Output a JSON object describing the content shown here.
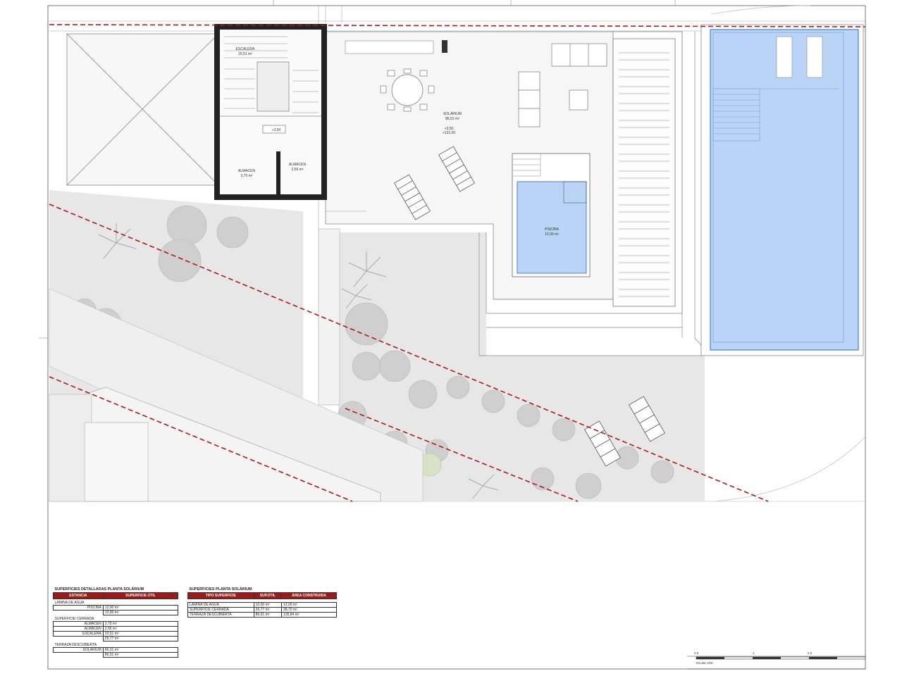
{
  "plan": {
    "rooms": {
      "escalera": {
        "name": "ESCALERA",
        "area": "20,51 m²"
      },
      "almacen_left": {
        "name": "ALMACÉN",
        "area": "3,70 m²"
      },
      "almacen_right": {
        "name": "ALMACÉN",
        "area": "2,56 m²"
      },
      "solarium": {
        "name": "SOLÁRIUM",
        "area": "86,01 m²"
      },
      "piscina": {
        "name": "PISCINA",
        "area": "12,00 m²"
      }
    },
    "levels": {
      "stair_level": "+3,50",
      "solarium_level_1": "+3,50",
      "solarium_level_2": "+121,00"
    }
  },
  "table_left": {
    "title": "SUPERFICIES DETALLADAS PLANTA SOLÁRIUM",
    "headers": [
      "ESTANCIA",
      "SUPERFICIE ÚTIL"
    ],
    "groups": [
      {
        "name": "LÁMINA DE AGUA",
        "rows": [
          {
            "label": "PISCINA",
            "value": "12,00 m²"
          }
        ],
        "total": "12,00 m²"
      },
      {
        "name": "SUPERFICIE CERRADA",
        "rows": [
          {
            "label": "ALMACÉN",
            "value": "3,70 m²"
          },
          {
            "label": "ALMACÉN",
            "value": "2,56 m²"
          },
          {
            "label": "ESCALERA",
            "value": "20,51 m²"
          }
        ],
        "total": "26,77 m²"
      },
      {
        "name": "TERRAZA DESCUBIERTA",
        "rows": [
          {
            "label": "SOLÁRIUM",
            "value": "86,01 m²"
          }
        ],
        "total": "86,01 m²"
      }
    ]
  },
  "table_right": {
    "title": "SUPERFICIES PLANTA SOLÁRIUM",
    "headers": [
      "TIPO SUPERFICIE",
      "SUP.ÚTIL",
      "ÁREA CONSTRUIDA"
    ],
    "rows": [
      [
        "LÁMINA DE AGUA",
        "12,00 m²",
        "12,00 m²"
      ],
      [
        "SUPERFICIE CERRADA",
        "26,77 m²",
        "38,70 m²"
      ],
      [
        "TERRAZA DESCUBIERTA",
        "86,01 m²",
        "135,84 m²"
      ]
    ]
  },
  "scale_bar": {
    "ticks": [
      "0,0",
      "1",
      "2,0"
    ],
    "label": "Escala 1/50"
  },
  "colors": {
    "pool_fill": "#b9d4f7",
    "pool_stroke": "#4a7fd6",
    "property_line": "#b01818",
    "header_red": "#9b1b1b",
    "garden": "#e6e6e6",
    "tree": "#c9c9c9",
    "tree_green": "#d5dfc5"
  }
}
